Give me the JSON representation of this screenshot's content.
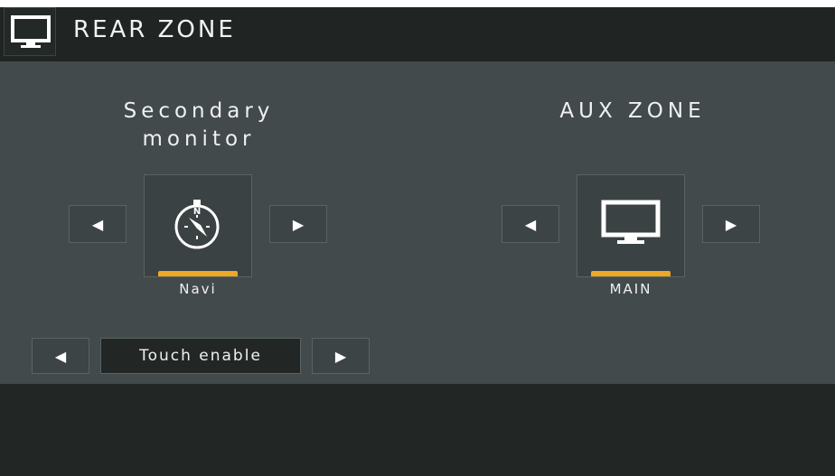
{
  "header": {
    "title": "REAR ZONE",
    "icon": "monitor-icon"
  },
  "secondary": {
    "title_line1": "Secondary",
    "title_line2": "monitor",
    "prev_arrow": "◀",
    "next_arrow": "▶",
    "source_label": "Navi",
    "source_icon": "compass-icon"
  },
  "aux": {
    "title": "AUX ZONE",
    "prev_arrow": "◀",
    "next_arrow": "▶",
    "source_label": "MAIN",
    "source_icon": "monitor-icon"
  },
  "touch": {
    "prev_arrow": "◀",
    "next_arrow": "▶",
    "label": "Touch enable"
  },
  "colors": {
    "accent": "#f0a722",
    "panel": "#434a4b",
    "dark": "#222726"
  }
}
